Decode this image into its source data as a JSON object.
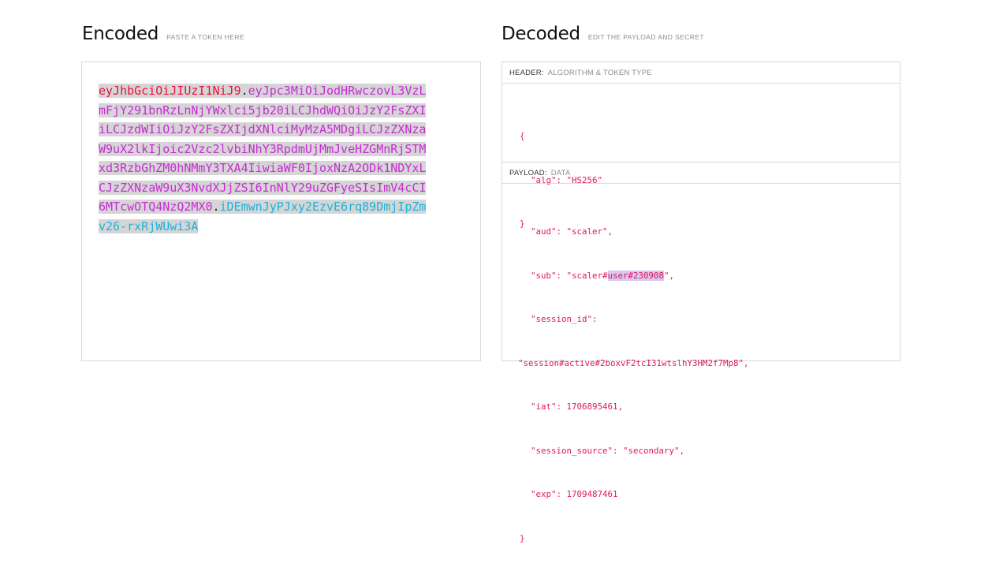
{
  "encoded": {
    "title": "Encoded",
    "subtitle": "PASTE A TOKEN HERE",
    "token_header": "eyJhbGciOiJIUzI1NiJ9",
    "dot1": ".",
    "token_payload": "eyJpc3MiOiJodHRwczovL3VzLmFjY291bnRzLnNjYWxlci5jb20iLCJhdWQiOiJzY2FsZXIiLCJzdWIiOiJzY2FsZXIjdXNlciMyMzA5MDgiLCJzZXNzaW9uX2lkIjoic2Vzc2lvbiNhY3RpdmUjMmJveHZGMnRjSTMxd3RzbGhZM0hNMmY3TXA4IiwiaWF0IjoxNzA2ODk1NDYxLCJzZXNzaW9uX3NvdXJjZSI6InNlY29uZGFyeSIsImV4cCI6MTcwOTQ4NzQ2MX0",
    "dot2": ".",
    "token_signature": "iDEmwnJyPJxy2EzvE6rq89DmjIpZmv26-rxRjWUwi3A"
  },
  "decoded": {
    "title": "Decoded",
    "subtitle": "EDIT THE PAYLOAD AND SECRET",
    "header_section": {
      "label": "HEADER:",
      "sublabel": "ALGORITHM & TOKEN TYPE",
      "open": "{",
      "line_alg": "\"alg\": \"HS256\"",
      "close": "}"
    },
    "payload_section": {
      "label": "PAYLOAD:",
      "sublabel": "DATA",
      "line_aud": "\"aud\": \"scaler\",",
      "line_sub_pre": "\"sub\": \"scaler#",
      "line_sub_hl": "user#230908",
      "line_sub_post": "\",",
      "line_session_id_key": "\"session_id\":",
      "line_session_id_val": "\"session#active#2boxvF2tcI31wtslhY3HM2f7Mp8\",",
      "line_iat": "\"iat\": 1706895461,",
      "line_session_source": "\"session_source\": \"secondary\",",
      "line_exp": "\"exp\": 1709487461",
      "close": "}"
    }
  },
  "colors": {
    "header": "#e8133d",
    "payload": "#c92bd6",
    "signature": "#1bb3dd"
  }
}
